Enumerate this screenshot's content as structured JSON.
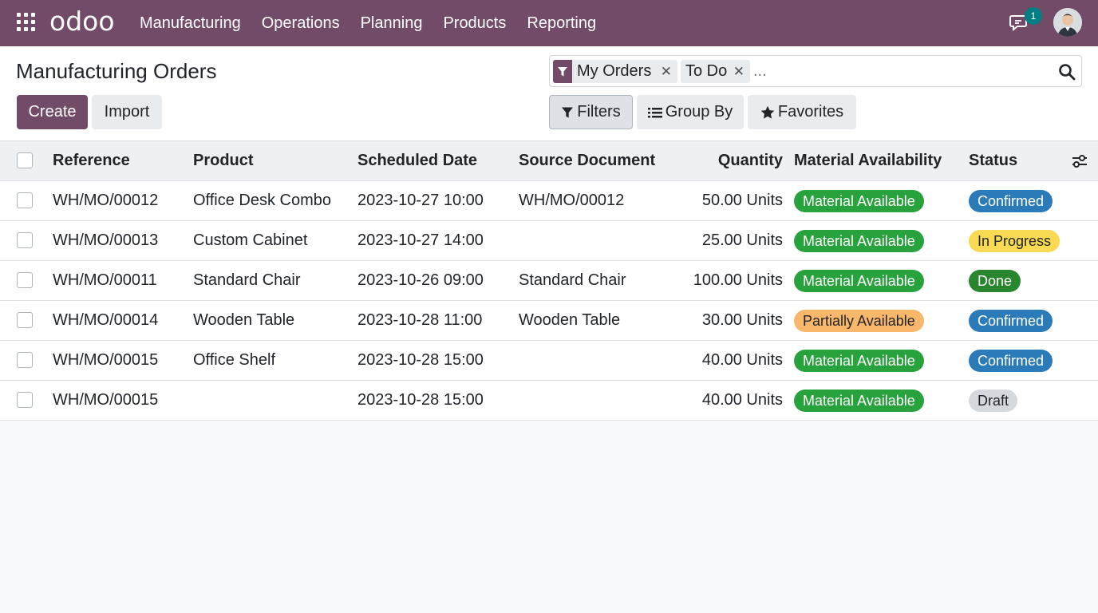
{
  "navbar": {
    "logo": "odoo",
    "menu": [
      "Manufacturing",
      "Operations",
      "Planning",
      "Products",
      "Reporting"
    ],
    "chat_badge": "1",
    "accent": "#714b67"
  },
  "control_panel": {
    "title": "Manufacturing Orders",
    "create_label": "Create",
    "import_label": "Import",
    "search": {
      "facets": [
        "My Orders",
        "To Do"
      ],
      "placeholder": "..."
    },
    "filters_label": "Filters",
    "groupby_label": "Group By",
    "favorites_label": "Favorites"
  },
  "table": {
    "columns": [
      "Reference",
      "Product",
      "Scheduled Date",
      "Source Document",
      "Quantity",
      "Material Availability",
      "Status"
    ],
    "rows": [
      {
        "reference": "WH/MO/00012",
        "product": "Office Desk Combo",
        "date": "2023-10-27 10:00",
        "source": "WH/MO/00012",
        "quantity": "50.00 Units",
        "availability": "Material Available",
        "status": "Confirmed"
      },
      {
        "reference": "WH/MO/00013",
        "product": "Custom Cabinet",
        "date": "2023-10-27 14:00",
        "source": "",
        "quantity": "25.00 Units",
        "availability": "Material Available",
        "status": "In Progress"
      },
      {
        "reference": "WH/MO/00011",
        "product": "Standard Chair",
        "date": "2023-10-26 09:00",
        "source": "Standard Chair",
        "quantity": "100.00 Units",
        "availability": "Material Available",
        "status": "Done"
      },
      {
        "reference": "WH/MO/00014",
        "product": "Wooden Table",
        "date": "2023-10-28 11:00",
        "source": "Wooden Table",
        "quantity": "30.00 Units",
        "availability": "Partially Available",
        "status": "Confirmed"
      },
      {
        "reference": "WH/MO/00015",
        "product": "Office Shelf",
        "date": "2023-10-28 15:00",
        "source": "",
        "quantity": "40.00 Units",
        "availability": "Material Available",
        "status": "Confirmed"
      },
      {
        "reference": "WH/MO/00015",
        "product": "",
        "date": "2023-10-28 15:00",
        "source": "",
        "quantity": "40.00 Units",
        "availability": "Material Available",
        "status": "Draft"
      }
    ]
  }
}
